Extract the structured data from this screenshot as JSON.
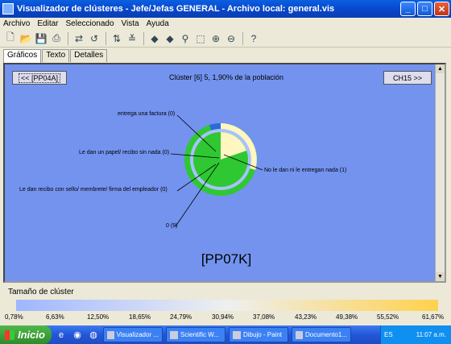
{
  "window": {
    "title": "Visualizador de clústeres - Jefe/Jefas GENERAL - Archivo local: general.vis",
    "min_icon": "minimize-icon",
    "max_icon": "maximize-icon",
    "close_icon": "close-icon"
  },
  "menu": [
    "Archivo",
    "Editar",
    "Seleccionado",
    "Vista",
    "Ayuda"
  ],
  "toolbar_icons": [
    "new-icon",
    "open-icon",
    "save-icon",
    "print-icon",
    "refresh-icon",
    "undo-icon",
    "sort-icon",
    "filter-icon",
    "arrow-left-icon",
    "arrow-right-icon",
    "find-icon",
    "select-icon",
    "zoom-in-icon",
    "zoom-out-icon",
    "help-icon"
  ],
  "tabs": [
    "Gráficos",
    "Texto",
    "Detalles"
  ],
  "nav": {
    "prev": "<< [PP04A]",
    "next": "CH15 >>"
  },
  "cluster": {
    "title": "Clúster [6] 5, 1,90% de la población",
    "code": "[PP07K]"
  },
  "chart_data": {
    "type": "pie",
    "labels": [
      "entrega una factura (0)",
      "Le dan un papel/ recibo sin nada (0)",
      "No le dan ni le entregan nada (1)",
      "Le dan recibo con sello/ membrete/ firma del empleador (0)",
      "0 (9)"
    ],
    "colors": {
      "cluster_main": "#2fc832",
      "cluster_other": "#fff6c0",
      "outer_blue": "#2a6bd8",
      "ring_bg": "#a8c2ff"
    }
  },
  "legend": {
    "title": "Tamaño de clúster",
    "ticks": [
      "0,78%",
      "6,63%",
      "12,50%",
      "18,65%",
      "24,79%",
      "30,94%",
      "37,08%",
      "43,23%",
      "49,38%",
      "55,52%",
      "61,67%"
    ]
  },
  "taskbar": {
    "start": "Inicio",
    "buttons": [
      "Visualizador ...",
      "Scientific W...",
      "Dibujo - Paint",
      "Documento1..."
    ],
    "lang": "ES",
    "clock": "11:07 a.m."
  }
}
